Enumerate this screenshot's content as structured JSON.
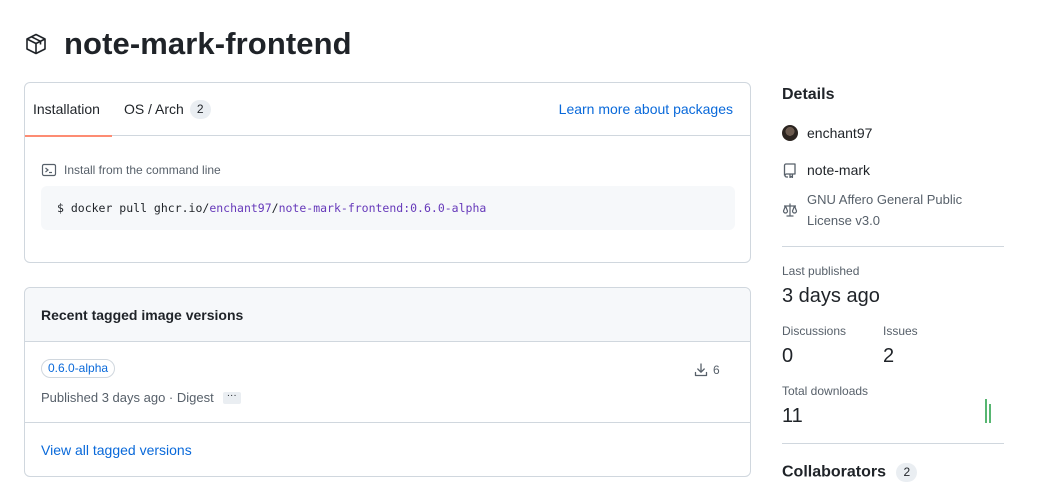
{
  "page": {
    "title": "note-mark-frontend",
    "icon": "package-icon"
  },
  "installation": {
    "tabs": [
      {
        "label": "Installation",
        "active": true
      },
      {
        "label": "OS / Arch",
        "count": "2",
        "active": false
      }
    ],
    "learn_more": "Learn more about packages",
    "command_label": "Install from the command line",
    "command": {
      "prefix": "$ docker pull ghcr.io/",
      "owner": "enchant97",
      "sep": "/",
      "image": "note-mark-frontend:0.6.0-alpha"
    }
  },
  "versions": {
    "header": "Recent tagged image versions",
    "items": [
      {
        "tag": "0.6.0-alpha",
        "downloads": "6",
        "published": "Published 3 days ago · Digest",
        "more": "···"
      }
    ],
    "view_all": "View all tagged versions"
  },
  "sidebar": {
    "details_title": "Details",
    "owner": "enchant97",
    "repository": "note-mark",
    "license": "GNU Affero General Public License v3.0",
    "last_published_label": "Last published",
    "last_published_value": "3 days ago",
    "discussions_label": "Discussions",
    "discussions_value": "0",
    "issues_label": "Issues",
    "issues_value": "2",
    "total_downloads_label": "Total downloads",
    "total_downloads_value": "11",
    "collaborators_title": "Collaborators",
    "collaborators_count": "2"
  },
  "colors": {
    "accent_link": "#0969da",
    "tab_underline": "#fd8c73",
    "sparkline": "#2da44e"
  }
}
